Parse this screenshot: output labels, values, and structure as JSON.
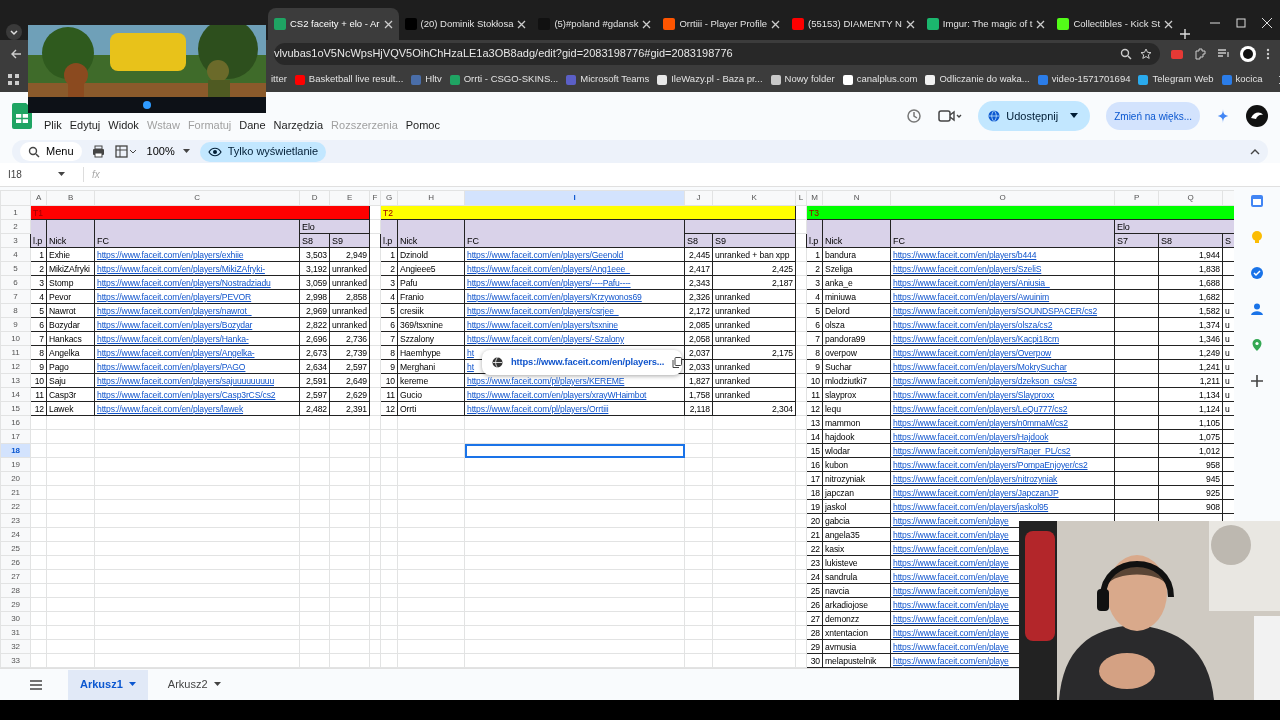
{
  "browser": {
    "tabs": [
      {
        "title": "CS2 faceity + elo - Ar",
        "selected": true,
        "color": "#1fa463"
      },
      {
        "title": "(20) Dominik Stokłosa",
        "selected": false,
        "color": "#000000"
      },
      {
        "title": "(5)#poland #gdansk",
        "selected": false,
        "color": "#111111"
      },
      {
        "title": "Orrtiii - Player Profile",
        "selected": false,
        "color": "#ff5500"
      },
      {
        "title": "(55153) DIAMENTY N",
        "selected": false,
        "color": "#ff0000"
      },
      {
        "title": "Imgur: The magic of t",
        "selected": false,
        "color": "#1bb76e"
      },
      {
        "title": "Collectibles - Kick St",
        "selected": false,
        "color": "#53fc18"
      }
    ],
    "address": "vlvubas1oV5NcWpsHjVQV5OihChHzaLE1a3OB8adg/edit?gid=2083198776#gid=2083198776",
    "bookmarks": [
      {
        "label": "itter"
      },
      {
        "label": "Basketball live result...",
        "color": "#ff0000"
      },
      {
        "label": "Hltv",
        "color": "#4a6ea9"
      },
      {
        "label": "Orrti - CSGO-SKINS...",
        "color": "#1fa463"
      },
      {
        "label": "Microsoft Teams",
        "color": "#5b5fc7"
      },
      {
        "label": "IleWazy.pl - Baza pr...",
        "color": "#e8e8e8"
      },
      {
        "label": "Nowy folder",
        "color": "#c8c8c8"
      },
      {
        "label": "canalplus.com",
        "color": "#ffffff"
      },
      {
        "label": "Odliczanie do waka...",
        "color": "#f0f0f0"
      },
      {
        "label": "video-1571701694",
        "color": "#2b7de9"
      },
      {
        "label": "Telegram Web",
        "color": "#2aabee"
      },
      {
        "label": "kocica",
        "color": "#2b7de9"
      }
    ]
  },
  "sheets_app": {
    "menu": [
      {
        "label": "Plik",
        "disabled": false
      },
      {
        "label": "Edytuj",
        "disabled": false
      },
      {
        "label": "Widok",
        "disabled": false
      },
      {
        "label": "Wstaw",
        "disabled": true
      },
      {
        "label": "Formatuj",
        "disabled": true
      },
      {
        "label": "Dane",
        "disabled": false
      },
      {
        "label": "Narzędzia",
        "disabled": false
      },
      {
        "label": "Rozszerzenia",
        "disabled": true
      },
      {
        "label": "Pomoc",
        "disabled": false
      }
    ],
    "share_button": "Udostępnij",
    "upgrade_button": "Zmień na więks...",
    "toolbar": {
      "search": "Menu",
      "zoom": "100%",
      "mode": "Tylko wyświetlanie"
    },
    "name_box": "I18",
    "formula_label": "fx"
  },
  "grid": {
    "column_headers": [
      {
        "label": "A",
        "selected": false
      },
      {
        "label": "B",
        "selected": false
      },
      {
        "label": "C",
        "selected": false
      },
      {
        "label": "D",
        "selected": false
      },
      {
        "label": "E",
        "selected": false
      },
      {
        "label": "F",
        "selected": false
      },
      {
        "label": "G",
        "selected": false
      },
      {
        "label": "H",
        "selected": false
      },
      {
        "label": "I",
        "selected": true
      },
      {
        "label": "J",
        "selected": false
      },
      {
        "label": "K",
        "selected": false
      },
      {
        "label": "L",
        "selected": false
      },
      {
        "label": "M",
        "selected": false
      },
      {
        "label": "N",
        "selected": false
      },
      {
        "label": "O",
        "selected": false
      },
      {
        "label": "P",
        "selected": false
      },
      {
        "label": "Q",
        "selected": false
      }
    ],
    "row_headers": [
      {
        "label": "1",
        "selected": false
      },
      {
        "label": "2",
        "selected": false
      },
      {
        "label": "3",
        "selected": false
      },
      {
        "label": "4",
        "selected": false
      },
      {
        "label": "5",
        "selected": false
      },
      {
        "label": "6",
        "selected": false
      },
      {
        "label": "7",
        "selected": false
      },
      {
        "label": "8",
        "selected": false
      },
      {
        "label": "9",
        "selected": false
      },
      {
        "label": "10",
        "selected": false
      },
      {
        "label": "11",
        "selected": false
      },
      {
        "label": "12",
        "selected": false
      },
      {
        "label": "13",
        "selected": false
      },
      {
        "label": "14",
        "selected": false
      },
      {
        "label": "15",
        "selected": false
      },
      {
        "label": "16",
        "selected": false
      },
      {
        "label": "17",
        "selected": false
      },
      {
        "label": "18",
        "selected": true
      },
      {
        "label": "19",
        "selected": false
      },
      {
        "label": "20",
        "selected": false
      },
      {
        "label": "21",
        "selected": false
      },
      {
        "label": "22",
        "selected": false
      },
      {
        "label": "23",
        "selected": false
      },
      {
        "label": "24",
        "selected": false
      },
      {
        "label": "25",
        "selected": false
      },
      {
        "label": "26",
        "selected": false
      },
      {
        "label": "27",
        "selected": false
      },
      {
        "label": "28",
        "selected": false
      },
      {
        "label": "29",
        "selected": false
      },
      {
        "label": "30",
        "selected": false
      },
      {
        "label": "31",
        "selected": false
      },
      {
        "label": "32",
        "selected": false
      },
      {
        "label": "33",
        "selected": false
      }
    ],
    "tables": [
      {
        "title": "T1",
        "color": "#ff0000",
        "elo_label": "Elo",
        "headers": [
          "l.p",
          "Nick",
          "FC"
        ],
        "elo_columns": [
          "S8",
          "S9"
        ],
        "rows": [
          {
            "lp": "1",
            "nick": "Exhie",
            "fc": "https://www.faceit.com/en/players/exhiie",
            "elo": {
              "col_1": "3,503",
              "col_2": "2,949"
            }
          },
          {
            "lp": "2",
            "nick": "MikiZAfryki",
            "fc": "https://www.faceit.com/en/players/MikiZAfryki-",
            "elo": {
              "col_1": "3,192",
              "col_2": "unranked"
            }
          },
          {
            "lp": "3",
            "nick": "Stomp",
            "fc": "https://www.faceit.com/en/players/Nostradziadu",
            "elo": {
              "col_1": "3,059",
              "col_2": "unranked"
            }
          },
          {
            "lp": "4",
            "nick": "Pevor",
            "fc": "https://www.faceit.com/en/players/PEVOR",
            "elo": {
              "col_1": "2,998",
              "col_2": "2,858"
            }
          },
          {
            "lp": "5",
            "nick": "Nawrot",
            "fc": "https://www.faceit.com/en/players/nawrot_",
            "elo": {
              "col_1": "2,969",
              "col_2": "unranked"
            }
          },
          {
            "lp": "6",
            "nick": "Bozydar",
            "fc": "https://www.faceit.com/en/players/Bozydar",
            "elo": {
              "col_1": "2,822",
              "col_2": "unranked"
            }
          },
          {
            "lp": "7",
            "nick": "Hankacs",
            "fc": "https://www.faceit.com/en/players/Hanka-",
            "elo": {
              "col_1": "2,696",
              "col_2": "2,736"
            }
          },
          {
            "lp": "8",
            "nick": "Angelka",
            "fc": "https://www.faceit.com/en/players/Angelka-",
            "elo": {
              "col_1": "2,673",
              "col_2": "2,739"
            }
          },
          {
            "lp": "9",
            "nick": "Pago",
            "fc": "https://www.faceit.com/en/players/PAGO",
            "elo": {
              "col_1": "2,634",
              "col_2": "2,597"
            }
          },
          {
            "lp": "10",
            "nick": "Saju",
            "fc": "https://www.faceit.com/en/players/sajuuuuuuuuu",
            "elo": {
              "col_1": "2,591",
              "col_2": "2,649"
            }
          },
          {
            "lp": "11",
            "nick": "Casp3r",
            "fc": "https://www.faceit.com/en/players/Casp3rCS/cs2",
            "elo": {
              "col_1": "2,597",
              "col_2": "2,629"
            }
          },
          {
            "lp": "12",
            "nick": "Lawek",
            "fc": "https://www.faceit.com/en/players/lawek",
            "elo": {
              "col_1": "2,482",
              "col_2": "2,391"
            }
          }
        ]
      },
      {
        "title": "T2",
        "color": "#ffff00",
        "headers": [
          "l.p",
          "Nick",
          "FC"
        ],
        "elo_columns": [
          "S8",
          "S9"
        ],
        "rows": [
          {
            "lp": "1",
            "nick": "Dzinold",
            "fc": "https://www.faceit.com/en/players/Geenold",
            "elo": {
              "col_1": "2,445",
              "col_2": "unranked + ban xpp"
            }
          },
          {
            "lp": "2",
            "nick": "Angieee5",
            "fc": "https://www.faceit.com/en/players/Ang1eee_",
            "elo": {
              "col_1": "2,417",
              "col_2": "2,425"
            }
          },
          {
            "lp": "3",
            "nick": "Pafu",
            "fc": "https://www.faceit.com/en/players/----Pafu----",
            "elo": {
              "col_1": "2,343",
              "col_2": "2,187"
            }
          },
          {
            "lp": "4",
            "nick": "Franio",
            "fc": "https://www.faceit.com/en/players/Krzywonos69",
            "elo": {
              "col_1": "2,326",
              "col_2": "unranked"
            }
          },
          {
            "lp": "5",
            "nick": "cresiik",
            "fc": "https://www.faceit.com/en/players/csrjee_",
            "elo": {
              "col_1": "2,172",
              "col_2": "unranked"
            }
          },
          {
            "lp": "6",
            "nick": "369/tsxnine",
            "fc": "https://www.faceit.com/en/players/tsxnine",
            "elo": {
              "col_1": "2,085",
              "col_2": "unranked"
            }
          },
          {
            "lp": "7",
            "nick": "Szzalony",
            "fc": "https://www.faceit.com/en/players/-Szalony",
            "elo": {
              "col_1": "2,058",
              "col_2": "unranked"
            }
          },
          {
            "lp": "8",
            "nick": "Haemhype",
            "fc": "ht",
            "elo": {
              "col_1": "2,037",
              "col_2": "2,175"
            }
          },
          {
            "lp": "9",
            "nick": "Merghani",
            "fc": "ht",
            "elo": {
              "col_1": "2,033",
              "col_2": "unranked"
            }
          },
          {
            "lp": "10",
            "nick": "kereme",
            "fc": "https://www.faceit.com/pl/players/KEREME",
            "elo": {
              "col_1": "1,827",
              "col_2": "unranked"
            }
          },
          {
            "lp": "11",
            "nick": "Gucio",
            "fc": "https://www.faceit.com/en/players/xrayWHaimbot",
            "elo": {
              "col_1": "1,758",
              "col_2": "unranked"
            }
          },
          {
            "lp": "12",
            "nick": "Orrti",
            "fc": "https://www.faceit.com/pl/players/Orrtiii",
            "elo": {
              "col_1": "2,118",
              "col_2": "2,304"
            }
          }
        ]
      },
      {
        "title": "T3",
        "color": "#00ff00",
        "elo_label": "Elo",
        "headers": [
          "l.p",
          "Nick",
          "FC"
        ],
        "elo_columns": [
          "S7",
          "S8",
          "S"
        ],
        "rows": [
          {
            "lp": "1",
            "nick": "bandura",
            "fc": "https://www.faceit.com/en/players/b444",
            "elo": {
              "col_2": "1,944"
            }
          },
          {
            "lp": "2",
            "nick": "Szeliga",
            "fc": "https://www.faceit.com/en/players/SzeliS",
            "elo": {
              "col_2": "1,838"
            }
          },
          {
            "lp": "3",
            "nick": "anka_e",
            "fc": "https://www.faceit.com/en/players/Aniusia_",
            "elo": {
              "col_2": "1,688"
            }
          },
          {
            "lp": "4",
            "nick": "miniuwa",
            "fc": "https://www.faceit.com/en/players/Awuinim",
            "elo": {
              "col_2": "1,682"
            }
          },
          {
            "lp": "5",
            "nick": "Delord",
            "fc": "https://www.faceit.com/en/players/SOUNDSPACER/cs2",
            "elo": {
              "col_2": "1,582",
              "col_3": "u"
            }
          },
          {
            "lp": "6",
            "nick": "olsza",
            "fc": "https://www.faceit.com/en/players/olsza/cs2",
            "elo": {
              "col_2": "1,374",
              "col_3": "u"
            }
          },
          {
            "lp": "7",
            "nick": "pandora99",
            "fc": "https://www.faceit.com/en/players/Kacpi18cm",
            "elo": {
              "col_2": "1,346",
              "col_3": "u"
            }
          },
          {
            "lp": "8",
            "nick": "overpow",
            "fc": "https://www.faceit.com/en/players/Overpow",
            "elo": {
              "col_2": "1,249",
              "col_3": "u"
            }
          },
          {
            "lp": "9",
            "nick": "Suchar",
            "fc": "https://www.faceit.com/en/players/MokrySuchar",
            "elo": {
              "col_2": "1,241",
              "col_3": "u"
            }
          },
          {
            "lp": "10",
            "nick": "mlodziutki7",
            "fc": "https://www.faceit.com/en/players/dzekson_cs/cs2",
            "elo": {
              "col_2": "1,211",
              "col_3": "u"
            }
          },
          {
            "lp": "11",
            "nick": "slayprox",
            "fc": "https://www.faceit.com/en/players/Slayproxx",
            "elo": {
              "col_2": "1,134",
              "col_3": "u"
            }
          },
          {
            "lp": "12",
            "nick": "lequ",
            "fc": "https://www.faceit.com/en/players/LeQu777/cs2",
            "elo": {
              "col_2": "1,124",
              "col_3": "u"
            }
          },
          {
            "lp": "13",
            "nick": "mammon",
            "fc": "https://www.faceit.com/en/players/n0mmaM/cs2",
            "elo": {
              "col_2": "1,105"
            }
          },
          {
            "lp": "14",
            "nick": "hajdook",
            "fc": "https://www.faceit.com/en/players/Hajdook",
            "elo": {
              "col_2": "1,075"
            }
          },
          {
            "lp": "15",
            "nick": "wlodar",
            "fc": "https://www.faceit.com/en/players/Rager_PL/cs2",
            "elo": {
              "col_2": "1,012"
            }
          },
          {
            "lp": "16",
            "nick": "kubon",
            "fc": "https://www.faceit.com/en/players/PompaEnjoyer/cs2",
            "elo": {
              "col_2": "958"
            }
          },
          {
            "lp": "17",
            "nick": "nitrozyniak",
            "fc": "https://www.faceit.com/en/players/nitrozyniak",
            "elo": {
              "col_2": "945"
            }
          },
          {
            "lp": "18",
            "nick": "japczan",
            "fc": "https://www.faceit.com/en/players/JapczanJP",
            "elo": {
              "col_2": "925"
            }
          },
          {
            "lp": "19",
            "nick": "jaskol",
            "fc": "https://www.faceit.com/en/players/jaskol95",
            "elo": {
              "col_2": "908"
            }
          },
          {
            "lp": "20",
            "nick": "gabcia",
            "fc": "https://www.faceit.com/en/playe"
          },
          {
            "lp": "21",
            "nick": "angela35",
            "fc": "https://www.faceit.com/en/playe"
          },
          {
            "lp": "22",
            "nick": "kasix",
            "fc": "https://www.faceit.com/en/playe"
          },
          {
            "lp": "23",
            "nick": "lukisteve",
            "fc": "https://www.faceit.com/en/playe"
          },
          {
            "lp": "24",
            "nick": "sandrula",
            "fc": "https://www.faceit.com/en/playe"
          },
          {
            "lp": "25",
            "nick": "navcia",
            "fc": "https://www.faceit.com/en/playe"
          },
          {
            "lp": "26",
            "nick": "arkadiojose",
            "fc": "https://www.faceit.com/en/playe"
          },
          {
            "lp": "27",
            "nick": "demonzz",
            "fc": "https://www.faceit.com/en/playe"
          },
          {
            "lp": "28",
            "nick": "xntentacion",
            "fc": "https://www.faceit.com/en/playe"
          },
          {
            "lp": "29",
            "nick": "avmusia",
            "fc": "https://www.faceit.com/en/playe"
          },
          {
            "lp": "30",
            "nick": "melapustelnik",
            "fc": "https://www.faceit.com/en/playe"
          }
        ]
      }
    ],
    "link_preview": {
      "url": "https://www.faceit.com/en/players..."
    }
  },
  "sheet_tabs": [
    {
      "label": "Arkusz1",
      "selected": true
    },
    {
      "label": "Arkusz2",
      "selected": false
    }
  ]
}
